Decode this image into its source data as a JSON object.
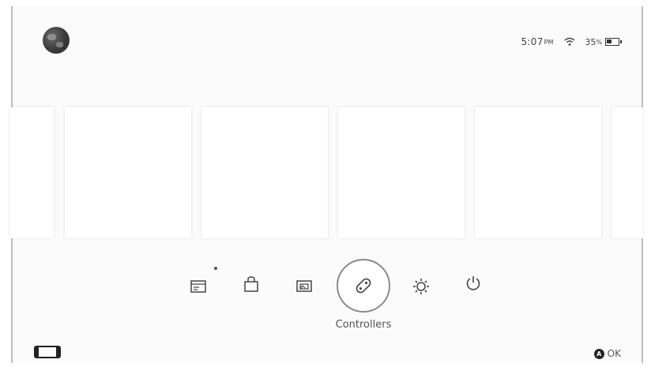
{
  "status_bar": {
    "time": "5:07",
    "ampm": "PM",
    "battery_percent": "35",
    "battery_percent_sign": "%",
    "wifi_icon": "wifi-icon",
    "battery_icon": "battery-icon"
  },
  "user": {
    "avatar_icon": "globe-avatar-icon"
  },
  "dock": {
    "items": [
      {
        "name": "news",
        "icon": "news-icon",
        "has_badge": true
      },
      {
        "name": "eshop",
        "icon": "shopping-bag-icon"
      },
      {
        "name": "album",
        "icon": "album-icon"
      },
      {
        "name": "controllers",
        "icon": "controller-icon",
        "selected": true
      },
      {
        "name": "system-settings",
        "icon": "gear-icon"
      },
      {
        "name": "sleep-mode",
        "icon": "power-icon"
      }
    ],
    "selected_label": "Controllers"
  },
  "footer": {
    "device_icon": "handheld-console-icon",
    "a_button": "A",
    "ok_label": "OK"
  },
  "colors": {
    "background": "#fbfbfb",
    "tile": "#ffffff",
    "icon": "#444444"
  }
}
